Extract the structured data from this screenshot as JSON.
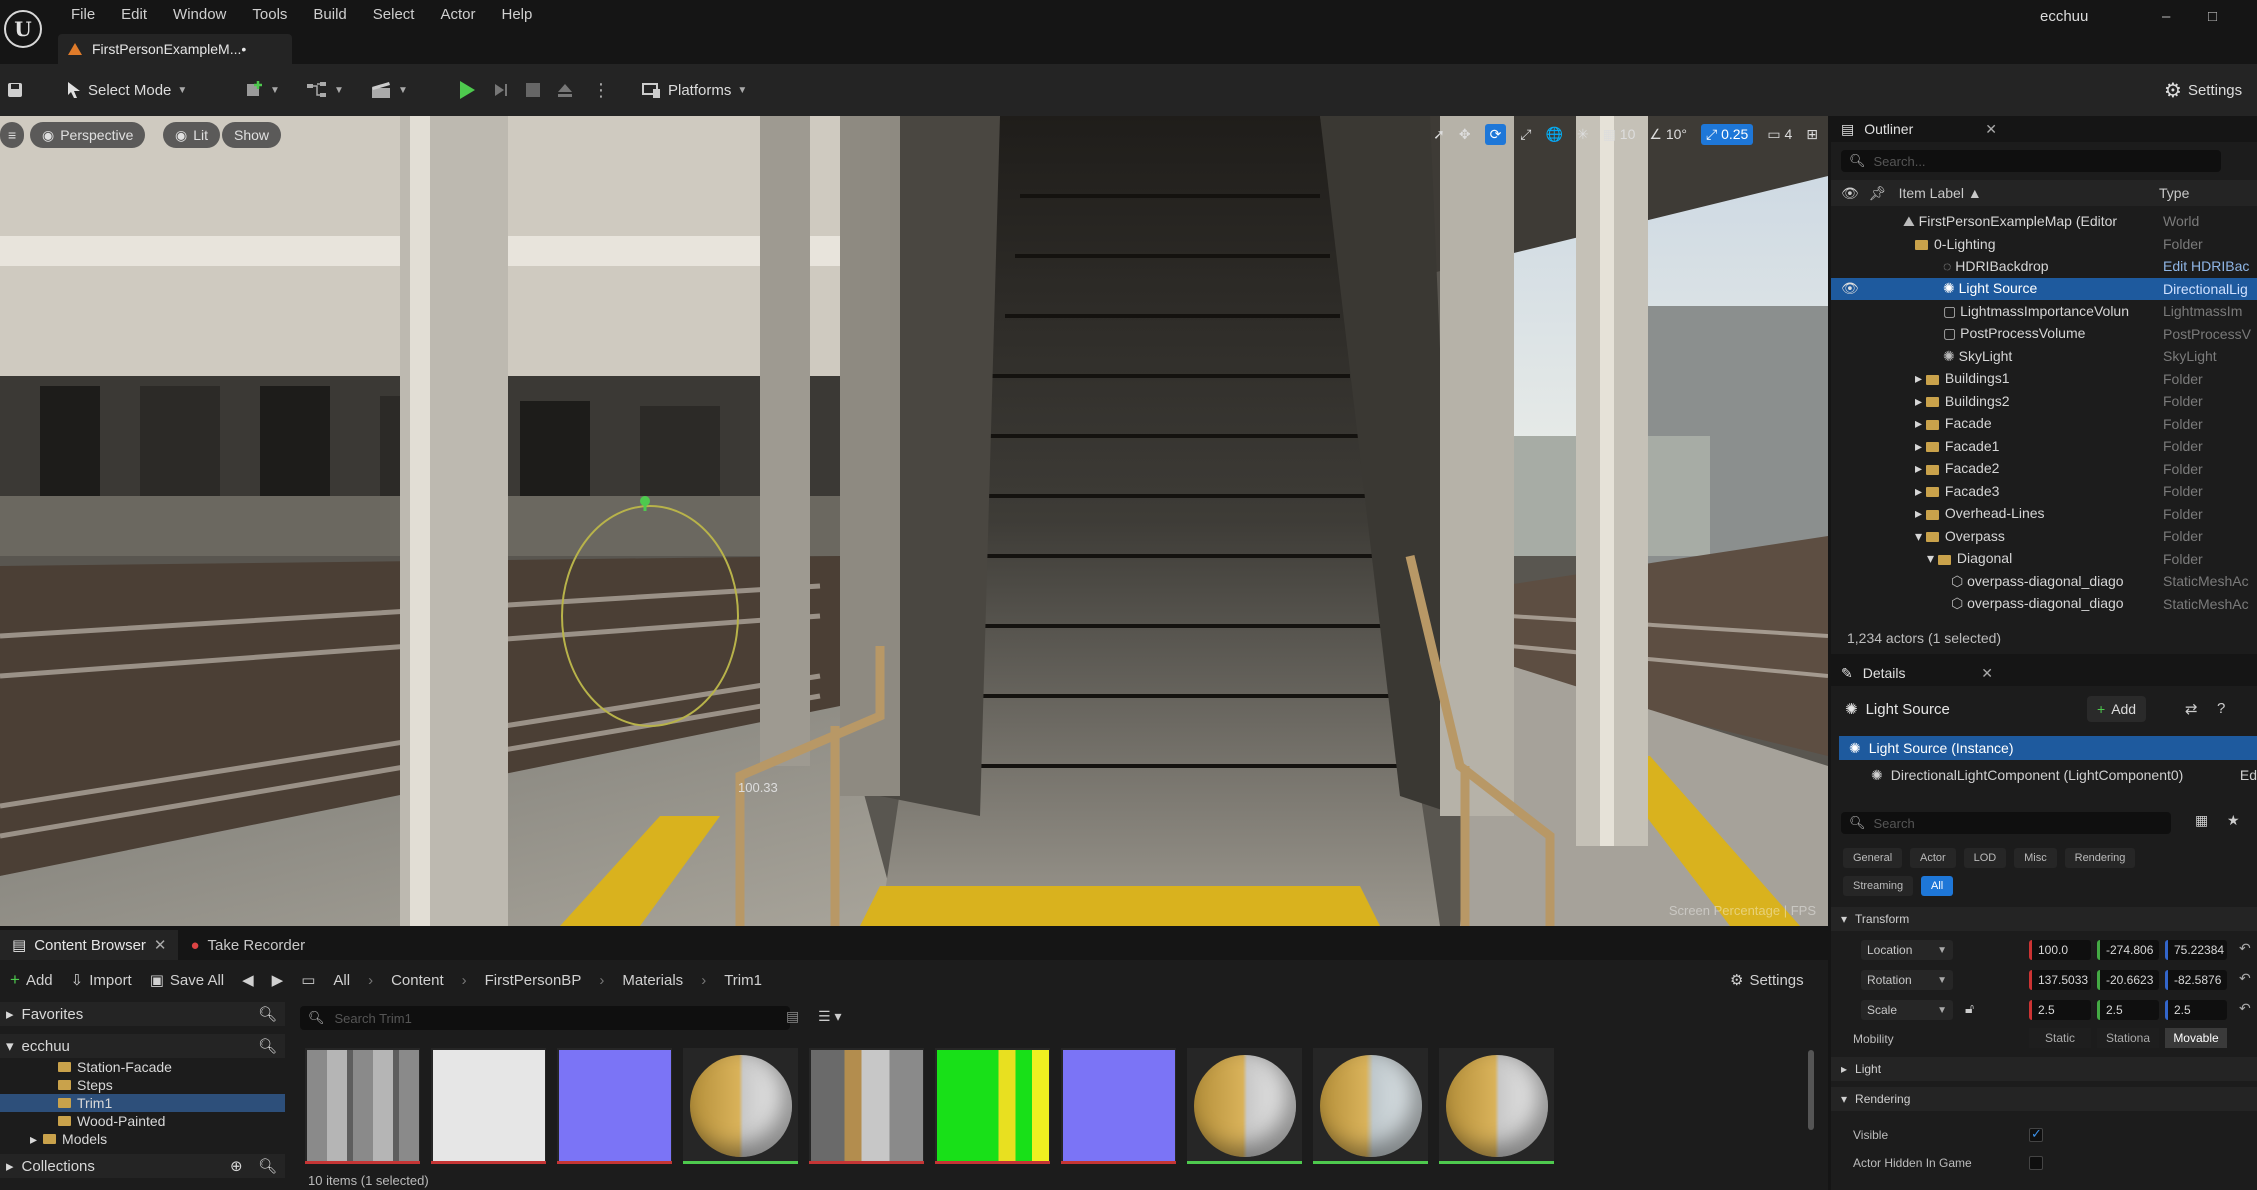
{
  "window": {
    "menus": [
      "File",
      "Edit",
      "Window",
      "Tools",
      "Build",
      "Select",
      "Actor",
      "Help"
    ],
    "doc_tab": "FirstPersonExampleM...•",
    "user": "ecchuu",
    "min": "–",
    "max": "□"
  },
  "toolbar": {
    "select_mode": "Select Mode",
    "platforms": "Platforms",
    "settings": "Settings"
  },
  "viewport": {
    "perspective": "Perspective",
    "lit": "Lit",
    "show": "Show",
    "grid_snap": "10",
    "rot_snap": "10°",
    "scale_snap": "0.25",
    "cam_speed": "4",
    "gizmo_value": "100.33",
    "overlay_text": "Screen Percentage | FPS"
  },
  "outliner": {
    "title": "Outliner",
    "search_placeholder": "Search...",
    "col_label": "Item Label ▲",
    "col_type": "Type",
    "rows": [
      {
        "label": "FirstPersonExampleMap (Editor",
        "type": "World"
      },
      {
        "label": "0-Lighting",
        "type": "Folder"
      },
      {
        "label": "HDRIBackdrop",
        "type": "Edit HDRIBac"
      },
      {
        "label": "Light Source",
        "type": "DirectionalLig"
      },
      {
        "label": "LightmassImportanceVolun",
        "type": "LightmassIm"
      },
      {
        "label": "PostProcessVolume",
        "type": "PostProcessV"
      },
      {
        "label": "SkyLight",
        "type": "SkyLight"
      },
      {
        "label": "Buildings1",
        "type": "Folder"
      },
      {
        "label": "Buildings2",
        "type": "Folder"
      },
      {
        "label": "Facade",
        "type": "Folder"
      },
      {
        "label": "Facade1",
        "type": "Folder"
      },
      {
        "label": "Facade2",
        "type": "Folder"
      },
      {
        "label": "Facade3",
        "type": "Folder"
      },
      {
        "label": "Overhead-Lines",
        "type": "Folder"
      },
      {
        "label": "Overpass",
        "type": "Folder"
      },
      {
        "label": "Diagonal",
        "type": "Folder"
      },
      {
        "label": "overpass-diagonal_diago",
        "type": "StaticMeshAc"
      },
      {
        "label": "overpass-diagonal_diago",
        "type": "StaticMeshAc"
      }
    ],
    "actor_count": "1,234 actors (1 selected)"
  },
  "details": {
    "title": "Details",
    "object_name": "Light Source",
    "add_label": "Add",
    "instance": "Light Source (Instance)",
    "component": "DirectionalLightComponent (LightComponent0)",
    "component_edit": "Ed",
    "search_placeholder": "Search",
    "filters_row1": [
      "General",
      "Actor",
      "LOD",
      "Misc",
      "Rendering"
    ],
    "filters_row2": [
      "Streaming",
      "All"
    ],
    "sec_transform": "Transform",
    "location_label": "Location",
    "location": [
      "100.0",
      "-274.806",
      "75.22384"
    ],
    "rotation_label": "Rotation",
    "rotation": [
      "137.5033",
      "-20.6623",
      "-82.5876"
    ],
    "scale_label": "Scale",
    "scale": [
      "2.5",
      "2.5",
      "2.5"
    ],
    "mobility_label": "Mobility",
    "mobility": [
      "Static",
      "Stationa",
      "Movable"
    ],
    "sec_light": "Light",
    "sec_rendering": "Rendering",
    "visible_label": "Visible",
    "hidden_label": "Actor Hidden In Game"
  },
  "content_browser": {
    "tab": "Content Browser",
    "tab2": "Take Recorder",
    "add": "Add",
    "import": "Import",
    "save_all": "Save All",
    "crumbs": [
      "All",
      "Content",
      "FirstPersonBP",
      "Materials",
      "Trim1"
    ],
    "settings": "Settings",
    "favorites": "Favorites",
    "root": "ecchuu",
    "folders": [
      "Station-Facade",
      "Steps",
      "Trim1",
      "Wood-Painted",
      "Models"
    ],
    "collections": "Collections",
    "search_placeholder": "Search Trim1",
    "item_count": "10 items (1 selected)"
  },
  "colors": {
    "accent": "#1e77d8",
    "selection": "#1e5a9e",
    "play": "#4ec94e",
    "folder": "#c9a24b"
  }
}
